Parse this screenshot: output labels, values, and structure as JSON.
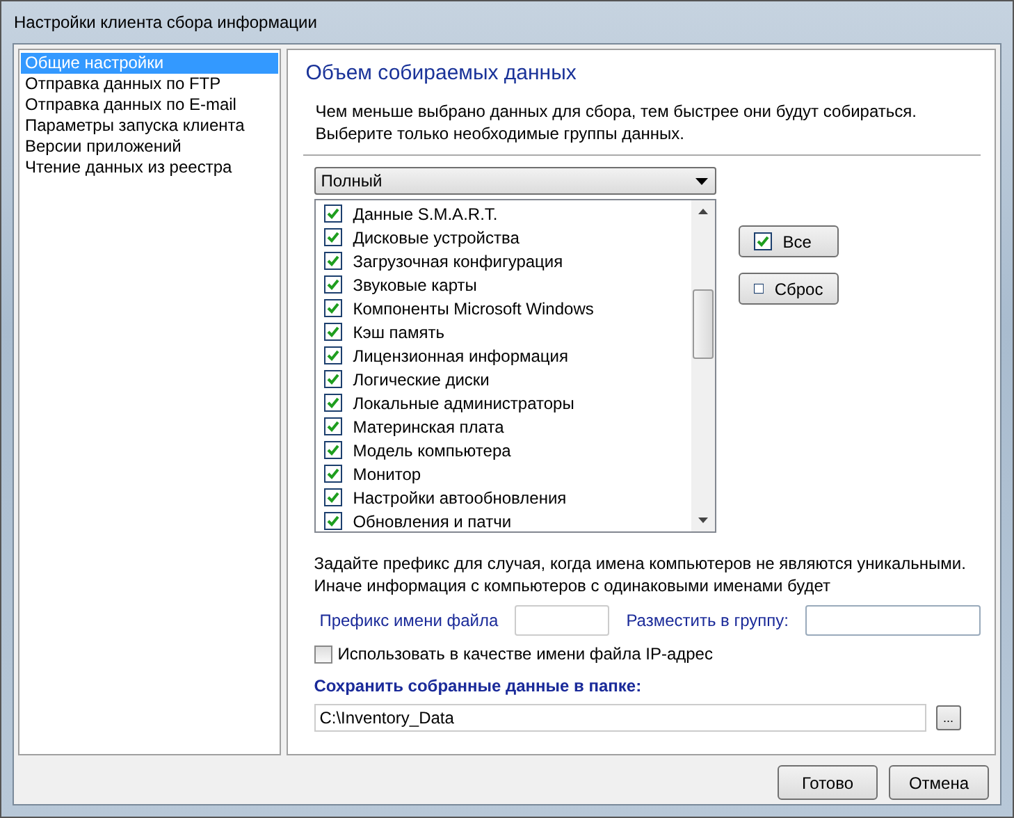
{
  "window": {
    "title": "Настройки клиента сбора информации"
  },
  "sidebar": {
    "items": [
      {
        "label": "Общие настройки",
        "selected": true
      },
      {
        "label": "Отправка данных по FTP",
        "selected": false
      },
      {
        "label": "Отправка данных по E-mail",
        "selected": false
      },
      {
        "label": "Параметры запуска клиента",
        "selected": false
      },
      {
        "label": "Версии приложений",
        "selected": false
      },
      {
        "label": "Чтение данных из реестра",
        "selected": false
      }
    ]
  },
  "content": {
    "heading": "Объем собираемых данных",
    "description": [
      "Чем меньше выбрано данных для сбора, тем быстрее они будут собираться.",
      "Выберите только необходимые группы данных."
    ],
    "preset_dropdown": {
      "value": "Полный"
    },
    "data_groups": [
      {
        "label": "Данные S.M.A.R.T.",
        "checked": true
      },
      {
        "label": "Дисковые устройства",
        "checked": true
      },
      {
        "label": "Загрузочная конфигурация",
        "checked": true
      },
      {
        "label": "Звуковые карты",
        "checked": true
      },
      {
        "label": "Компоненты Microsoft Windows",
        "checked": true
      },
      {
        "label": "Кэш память",
        "checked": true
      },
      {
        "label": "Лицензионная информация",
        "checked": true
      },
      {
        "label": "Логические диски",
        "checked": true
      },
      {
        "label": "Локальные администраторы",
        "checked": true
      },
      {
        "label": "Материнская плата",
        "checked": true
      },
      {
        "label": "Модель компьютера",
        "checked": true
      },
      {
        "label": "Монитор",
        "checked": true
      },
      {
        "label": "Настройки автообновления",
        "checked": true
      },
      {
        "label": "Обновления и патчи",
        "checked": true
      }
    ],
    "side_buttons": [
      {
        "label": "Все",
        "kind": "checked"
      },
      {
        "label": "Сброс",
        "kind": "unchecked"
      }
    ],
    "prefix_note": [
      "Задайте префикс для случая, когда имена компьютеров не являются уникальными.",
      "Иначе информация с компьютеров с одинаковыми именами будет"
    ],
    "prefix_label": "Префикс имени файла",
    "group_label": "Разместить в группу:",
    "ip_checkbox": {
      "label": "Использовать в качестве имени файла IP-адрес",
      "checked": false
    },
    "folder_label": "Сохранить собранные данные в папке:",
    "folder_field": {
      "value": "C:\\Inventory_Data"
    },
    "browse_button": "..."
  },
  "buttons": [
    "Готово",
    "Отмена"
  ]
}
